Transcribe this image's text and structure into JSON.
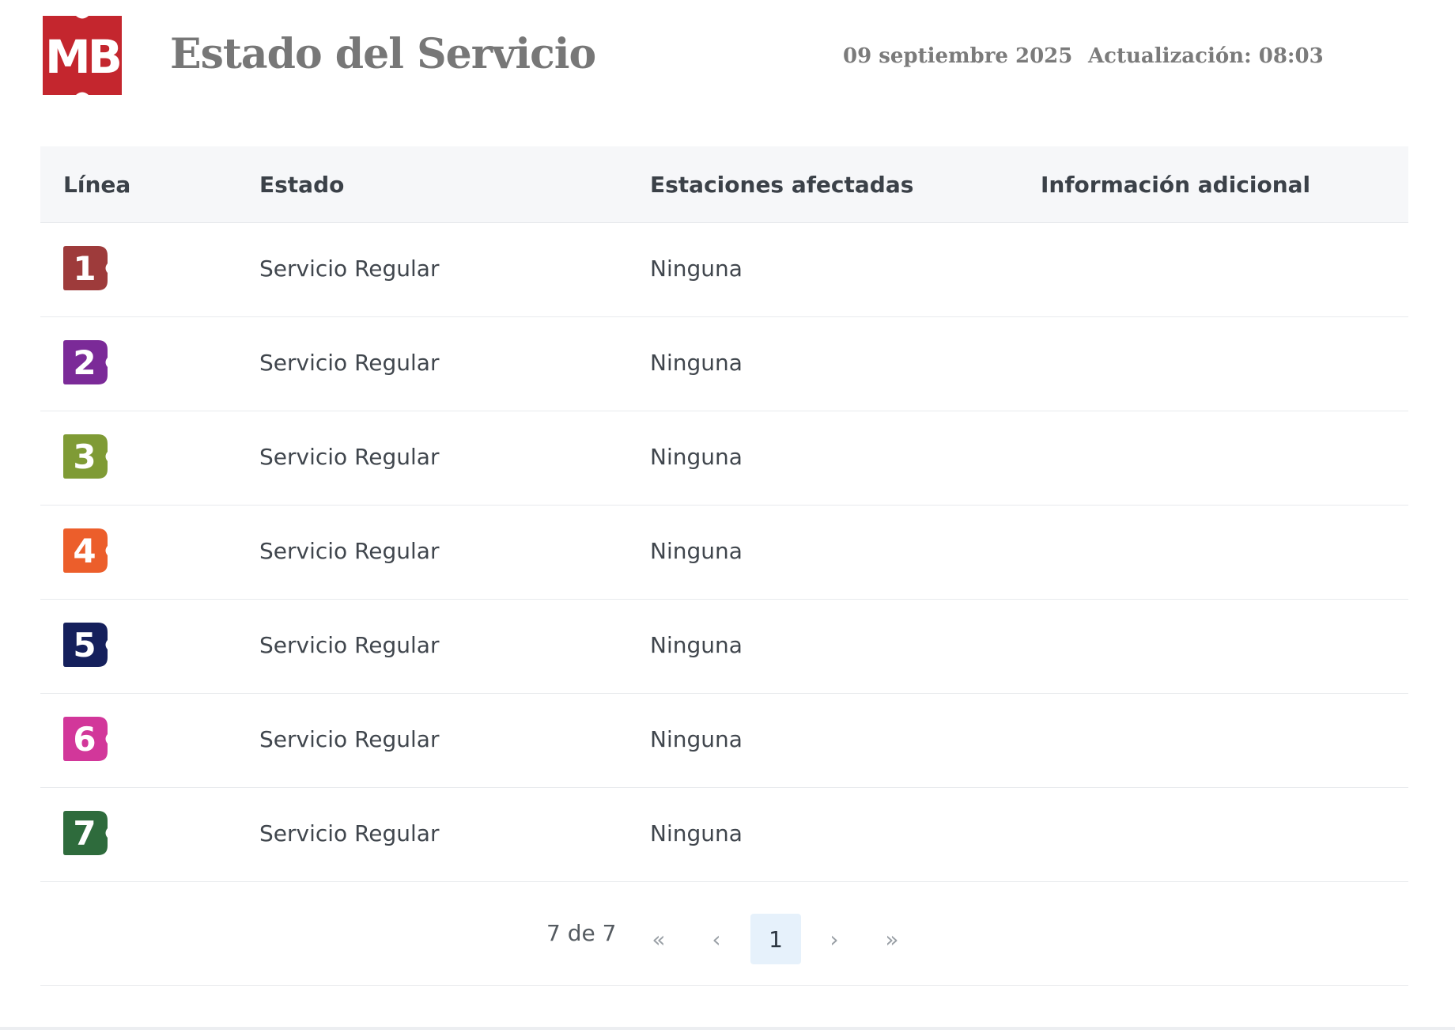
{
  "header": {
    "logo_text": "MB",
    "title": "Estado del Servicio",
    "date": "09 septiembre 2025",
    "update": "Actualización: 08:03",
    "brand_color": "#c4262e"
  },
  "table": {
    "columns": [
      "Línea",
      "Estado",
      "Estaciones afectadas",
      "Información adicional"
    ],
    "rows": [
      {
        "line": "1",
        "color": "#9e3b3b",
        "status": "Servicio Regular",
        "stations": "Ninguna",
        "info": ""
      },
      {
        "line": "2",
        "color": "#7b2a98",
        "status": "Servicio Regular",
        "stations": "Ninguna",
        "info": ""
      },
      {
        "line": "3",
        "color": "#7f9b35",
        "status": "Servicio Regular",
        "stations": "Ninguna",
        "info": ""
      },
      {
        "line": "4",
        "color": "#ec5e2b",
        "status": "Servicio Regular",
        "stations": "Ninguna",
        "info": ""
      },
      {
        "line": "5",
        "color": "#15205c",
        "status": "Servicio Regular",
        "stations": "Ninguna",
        "info": ""
      },
      {
        "line": "6",
        "color": "#d2379a",
        "status": "Servicio Regular",
        "stations": "Ninguna",
        "info": ""
      },
      {
        "line": "7",
        "color": "#2e6b3c",
        "status": "Servicio Regular",
        "stations": "Ninguna",
        "info": ""
      }
    ]
  },
  "pagination": {
    "count": "7 de 7",
    "first": "«",
    "prev": "‹",
    "page": "1",
    "next": "›",
    "last": "»"
  }
}
